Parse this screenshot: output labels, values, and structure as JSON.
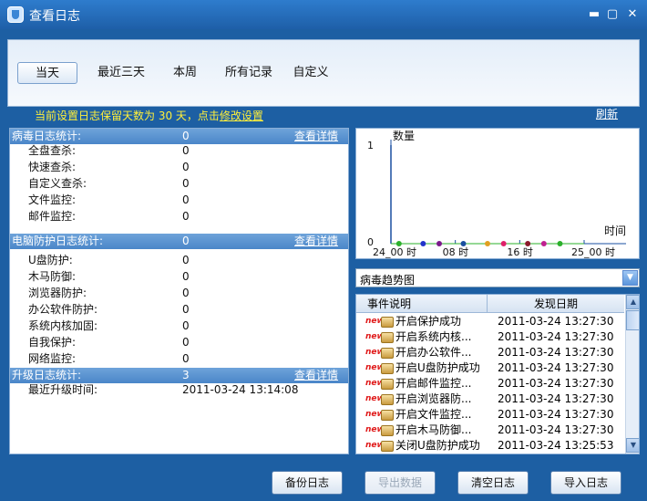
{
  "window": {
    "title": "查看日志"
  },
  "tabs": [
    {
      "label": "当天",
      "active": true
    },
    {
      "label": "最近三天"
    },
    {
      "label": "本周"
    },
    {
      "label": "所有记录"
    },
    {
      "label": "自定义"
    }
  ],
  "notice": {
    "text": "当前设置日志保留天数为 30 天，点击",
    "link": "修改设置"
  },
  "refresh_label": "刷新",
  "sections": [
    {
      "title": "病毒日志统计:",
      "count": "0",
      "detail_label": "查看详情",
      "rows": [
        {
          "label": "全盘查杀:",
          "value": "0"
        },
        {
          "label": "快速查杀:",
          "value": "0"
        },
        {
          "label": "自定义查杀:",
          "value": "0"
        },
        {
          "label": "文件监控:",
          "value": "0"
        },
        {
          "label": "邮件监控:",
          "value": "0"
        }
      ]
    },
    {
      "title": "电脑防护日志统计:",
      "count": "0",
      "detail_label": "查看详情",
      "rows": [
        {
          "label": "U盘防护:",
          "value": "0"
        },
        {
          "label": "木马防御:",
          "value": "0"
        },
        {
          "label": "浏览器防护:",
          "value": "0"
        },
        {
          "label": "办公软件防护:",
          "value": "0"
        },
        {
          "label": "系统内核加固:",
          "value": "0"
        },
        {
          "label": "自我保护:",
          "value": "0"
        },
        {
          "label": "网络监控:",
          "value": "0"
        }
      ]
    },
    {
      "title": "升级日志统计:",
      "count": "3",
      "detail_label": "查看详情",
      "rows": [
        {
          "label": "最近升级时间:",
          "value": "2011-03-24 13:14:08"
        }
      ]
    }
  ],
  "chart_data": {
    "type": "line",
    "ylabel": "数量",
    "xlabel": "时间",
    "y_ticks": [
      "0",
      "1"
    ],
    "ylim": [
      0,
      1
    ],
    "x_ticks": [
      "24_00 时",
      "08 时",
      "16 时",
      "25_00 时"
    ],
    "x_hours": [
      0,
      8,
      16,
      24
    ],
    "points": [
      {
        "hour": 1,
        "value": 0,
        "color": "#2bb02b"
      },
      {
        "hour": 4,
        "value": 0,
        "color": "#2233cc"
      },
      {
        "hour": 6,
        "value": 0,
        "color": "#7a1a8a"
      },
      {
        "hour": 9,
        "value": 0,
        "color": "#1a4fa0"
      },
      {
        "hour": 12,
        "value": 0,
        "color": "#e0a020"
      },
      {
        "hour": 14,
        "value": 0,
        "color": "#e0206a"
      },
      {
        "hour": 17,
        "value": 0,
        "color": "#8a1a2a"
      },
      {
        "hour": 19,
        "value": 0,
        "color": "#c02090"
      },
      {
        "hour": 21,
        "value": 0,
        "color": "#2bb02b"
      }
    ],
    "peak_hour": 0,
    "peak_value": 1
  },
  "chart_select": {
    "value": "病毒趋势图"
  },
  "events": {
    "columns": [
      "事件说明",
      "发现日期"
    ],
    "new_tag": "new",
    "rows": [
      {
        "desc": "开启保护成功",
        "date": "2011-03-24  13:27:30"
      },
      {
        "desc": "开启系统内核...",
        "date": "2011-03-24  13:27:30"
      },
      {
        "desc": "开启办公软件...",
        "date": "2011-03-24  13:27:30"
      },
      {
        "desc": "开启U盘防护成功",
        "date": "2011-03-24  13:27:30"
      },
      {
        "desc": "开启邮件监控...",
        "date": "2011-03-24  13:27:30"
      },
      {
        "desc": "开启浏览器防...",
        "date": "2011-03-24  13:27:30"
      },
      {
        "desc": "开启文件监控...",
        "date": "2011-03-24  13:27:30"
      },
      {
        "desc": "开启木马防御...",
        "date": "2011-03-24  13:27:30"
      },
      {
        "desc": "关闭U盘防护成功",
        "date": "2011-03-24  13:25:53"
      }
    ]
  },
  "buttons": {
    "backup": "备份日志",
    "export": "导出数据",
    "clear": "清空日志",
    "import": "导入日志"
  }
}
